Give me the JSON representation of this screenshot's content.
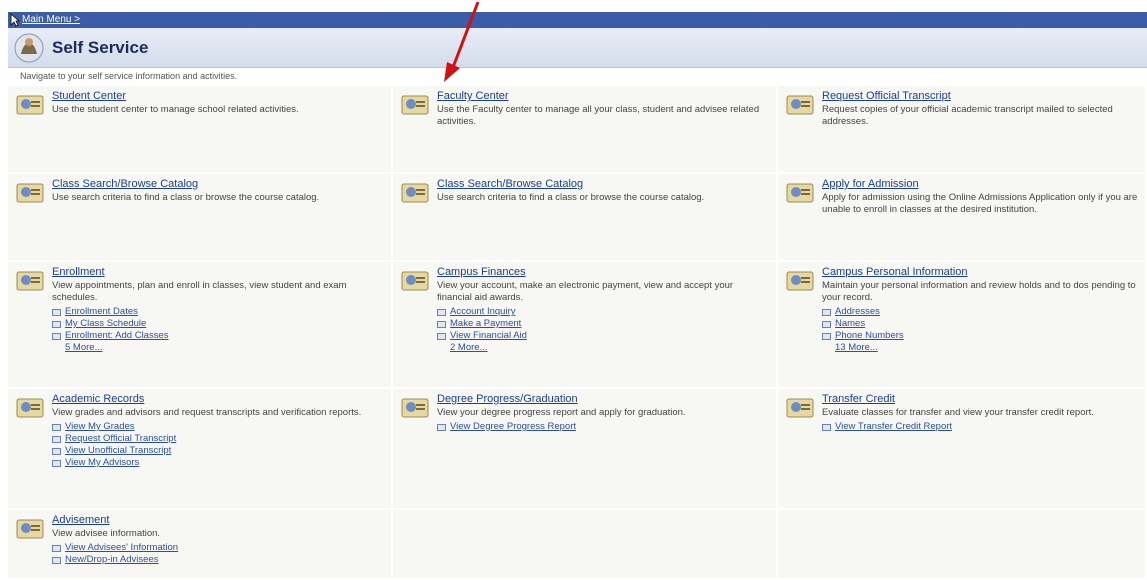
{
  "topbar": {
    "label": "Main Menu >"
  },
  "header": {
    "title": "Self Service"
  },
  "subtitle": "Navigate to your self service information and activities.",
  "cells": [
    {
      "title": "Student Center",
      "desc": "Use the student center to manage school related activities.",
      "links": [],
      "more": "",
      "icon": "student-center-icon"
    },
    {
      "title": "Faculty Center",
      "desc": "Use the Faculty center to manage all your class, student and advisee related activities.",
      "links": [],
      "more": "",
      "icon": "faculty-center-icon"
    },
    {
      "title": "Request Official Transcript",
      "desc": "Request copies of your official academic transcript mailed to selected addresses.",
      "links": [],
      "more": "",
      "icon": "transcript-icon"
    },
    {
      "title": "Class Search/Browse Catalog",
      "desc": "Use search criteria to find a class or browse the course catalog.",
      "links": [],
      "more": "",
      "icon": "class-search-icon"
    },
    {
      "title": "Class Search/Browse Catalog",
      "desc": "Use search criteria to find a class or browse the course catalog.",
      "links": [],
      "more": "",
      "icon": "class-search-icon"
    },
    {
      "title": "Apply for Admission",
      "desc": "Apply for admission using the Online Admissions Application only if you are unable to enroll in classes at the desired institution.",
      "links": [],
      "more": "",
      "icon": "apply-admission-icon"
    },
    {
      "title": "Enrollment",
      "desc": "View appointments, plan and enroll in classes, view student and exam schedules.",
      "links": [
        "Enrollment Dates",
        "My Class Schedule",
        "Enrollment: Add Classes"
      ],
      "more": "5 More...",
      "icon": "enrollment-icon"
    },
    {
      "title": "Campus Finances",
      "desc": "View your account, make an electronic payment, view and accept your financial aid awards.",
      "links": [
        "Account Inquiry",
        "Make a Payment",
        "View Financial Aid"
      ],
      "more": "2 More...",
      "icon": "campus-finances-icon"
    },
    {
      "title": "Campus Personal Information",
      "desc": "Maintain your personal information and review holds and to dos pending to your record.",
      "links": [
        "Addresses",
        "Names",
        "Phone Numbers"
      ],
      "more": "13 More...",
      "icon": "personal-info-icon"
    },
    {
      "title": "Academic Records",
      "desc": "View grades and advisors and request transcripts and verification reports.",
      "links": [
        "View My Grades",
        "Request Official Transcript",
        "View Unofficial Transcript",
        "View My Advisors"
      ],
      "more": "",
      "icon": "academic-records-icon"
    },
    {
      "title": "Degree Progress/Graduation",
      "desc": "View your degree progress report and apply for graduation.",
      "links": [
        "View Degree Progress Report"
      ],
      "more": "",
      "icon": "degree-progress-icon"
    },
    {
      "title": "Transfer Credit",
      "desc": "Evaluate classes for transfer and view your transfer credit report.",
      "links": [
        "View Transfer Credit Report"
      ],
      "more": "",
      "icon": "transfer-credit-icon"
    },
    {
      "title": "Advisement",
      "desc": "View advisee information.",
      "links": [
        "View Advisees' Information",
        "New/Drop-in Advisees"
      ],
      "more": "",
      "icon": "advisement-icon"
    }
  ]
}
